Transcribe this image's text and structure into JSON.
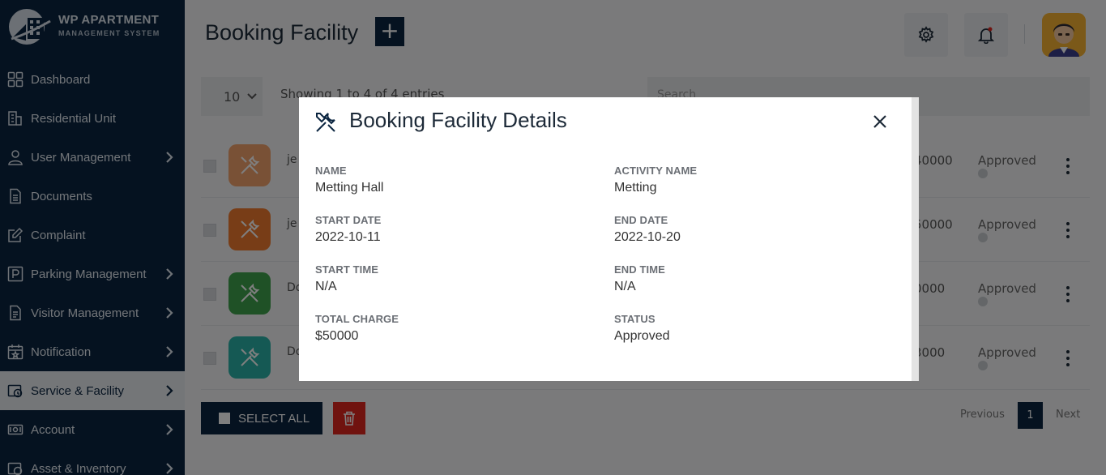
{
  "sidebar": {
    "logo_title": "WP APARTMENT",
    "logo_subtitle": "MANAGEMENT SYSTEM",
    "items": [
      {
        "label": "Dashboard",
        "icon": "grid-icon",
        "chevron": false
      },
      {
        "label": "Residential Unit",
        "icon": "building-icon",
        "chevron": false
      },
      {
        "label": "User Management",
        "icon": "user-icon",
        "chevron": true
      },
      {
        "label": "Documents",
        "icon": "document-icon",
        "chevron": false
      },
      {
        "label": "Complaint",
        "icon": "edit-icon",
        "chevron": false
      },
      {
        "label": "Parking Management",
        "icon": "parking-icon",
        "chevron": true
      },
      {
        "label": "Visitor Management",
        "icon": "visitor-icon",
        "chevron": true
      },
      {
        "label": "Notification",
        "icon": "calendar-icon",
        "chevron": true
      },
      {
        "label": "Service & Facility",
        "icon": "service-icon",
        "chevron": true,
        "active": true
      },
      {
        "label": "Account",
        "icon": "money-icon",
        "chevron": true
      },
      {
        "label": "Asset & Inventory",
        "icon": "asset-icon",
        "chevron": true
      }
    ]
  },
  "header": {
    "title": "Booking Facility",
    "add_label": "+"
  },
  "table_controls": {
    "length_value": "10",
    "info_text": "Showing 1 to 4 of 4 entries",
    "search_placeholder": "Search"
  },
  "rows": [
    {
      "user": "je",
      "charge": "40000",
      "status": "Approved",
      "icon_color": "#f2a36d"
    },
    {
      "user": "je",
      "charge": "50000",
      "status": "Approved",
      "icon_color": "#f07a2e"
    },
    {
      "user": "Do",
      "charge": "0000",
      "status": "Approved",
      "icon_color": "#3fa34d"
    },
    {
      "user": "Do",
      "charge": "3000",
      "status": "Approved",
      "icon_color": "#2bb3a8"
    }
  ],
  "footer": {
    "select_all_label": "SELECT ALL",
    "prev_label": "Previous",
    "page_number": "1",
    "next_label": "Next"
  },
  "modal": {
    "title": "Booking Facility Details",
    "fields": {
      "name_label": "NAME",
      "name_value": "Metting Hall",
      "activity_label": "ACTIVITY NAME",
      "activity_value": "Metting",
      "start_date_label": "START DATE",
      "start_date_value": "2022-10-11",
      "end_date_label": "END DATE",
      "end_date_value": "2022-10-20",
      "start_time_label": "START TIME",
      "start_time_value": "N/A",
      "end_time_label": "END TIME",
      "end_time_value": "N/A",
      "total_charge_label": "TOTAL CHARGE",
      "total_charge_value": "$50000",
      "status_label": "STATUS",
      "status_value": "Approved"
    }
  },
  "colors": {
    "sidebar_bg": "#0b2540",
    "accent": "#0b2540",
    "delete": "#e1261f"
  }
}
